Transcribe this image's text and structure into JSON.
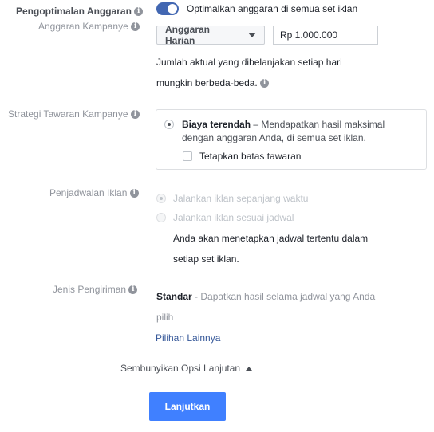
{
  "budget_optimization": {
    "label": "Pengoptimalan Anggaran",
    "toggle_text": "Optimalkan anggaran di semua set iklan",
    "toggle_on": true,
    "accent_color": "#4267b2"
  },
  "campaign_budget": {
    "label": "Anggaran Kampanye",
    "type_select": "Anggaran Harian",
    "amount": "Rp 1.000.000",
    "note_line1": "Jumlah aktual yang dibelanjakan setiap hari",
    "note_line2": "mungkin berbeda-beda."
  },
  "bid_strategy": {
    "label": "Strategi Tawaran Kampanye",
    "option_title": "Biaya terendah",
    "option_desc_line1": " – Mendapatkan hasil maksimal",
    "option_desc_line2": "dengan anggaran Anda, di semua set iklan.",
    "cap_label": "Tetapkan batas tawaran"
  },
  "ad_scheduling": {
    "label": "Penjadwalan Iklan",
    "option_all_time": "Jalankan iklan sepanjang waktu",
    "option_schedule": "Jalankan iklan sesuai jadwal",
    "note_line1": "Anda akan menetapkan jadwal tertentu dalam",
    "note_line2": "setiap set iklan."
  },
  "delivery_type": {
    "label": "Jenis Pengiriman",
    "title": "Standar",
    "desc_line1": " - Dapatkan hasil selama jadwal yang Anda",
    "desc_line2": "pilih",
    "more_options": "Pilihan Lainnya"
  },
  "advanced": {
    "hide_label": "Sembunyikan Opsi Lanjutan"
  },
  "footer": {
    "continue_label": "Lanjutkan",
    "button_color": "#4080ff"
  },
  "icons": {
    "info": "i"
  }
}
